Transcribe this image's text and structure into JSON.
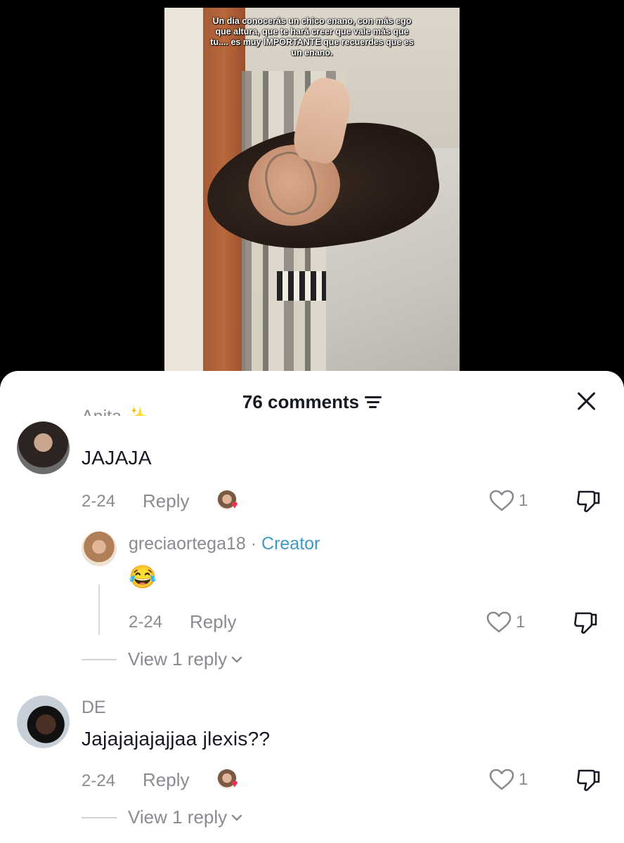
{
  "video": {
    "caption": "Un día conocerás un chico enano, con más ego que altura, que te hará creer que vale más que tu.... es muy IMPORTANTE que recuerdes que es un enano."
  },
  "comments_panel": {
    "title": "76 comments",
    "filter_icon": "filter-lines-icon",
    "close_icon": "close-icon"
  },
  "comments": [
    {
      "username": "Anita ✨",
      "text": "JAJAJA",
      "date": "2-24",
      "reply_label": "Reply",
      "likes": "1",
      "creator_liked": true,
      "reply": {
        "username": "greciaortega18",
        "separator": " · ",
        "badge": "Creator",
        "text": "😂",
        "date": "2-24",
        "reply_label": "Reply",
        "likes": "1"
      },
      "view_replies": "View 1 reply"
    },
    {
      "username": "DE",
      "text": "Jajajajajajjaa jlexis??",
      "date": "2-24",
      "reply_label": "Reply",
      "likes": "1",
      "creator_liked": true,
      "view_replies": "View 1 reply"
    }
  ],
  "colors": {
    "text_primary": "#161823",
    "text_secondary": "#8a8b91",
    "creator_badge": "#3e99c7",
    "heart": "#fe2c55"
  }
}
